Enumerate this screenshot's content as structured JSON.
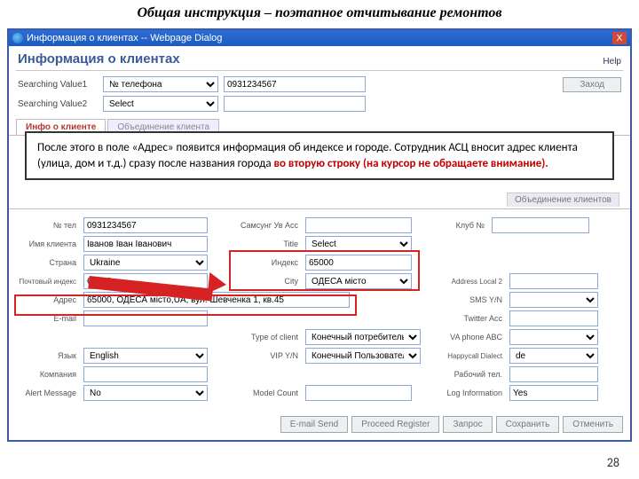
{
  "slide": {
    "title": "Общая инструкция – поэтапное отчитывание ремонтов",
    "page": "28"
  },
  "dialog": {
    "title": "Информация о клиентах -- Webpage Dialog",
    "close": "X"
  },
  "header": {
    "title": "Информация о клиентах",
    "help": "Help"
  },
  "search": {
    "label1": "Searching Value1",
    "sel1": "№ телефона",
    "val1": "0931234567",
    "label2": "Searching Value2",
    "sel2": "Select",
    "findBtn": "Заход"
  },
  "tabs": {
    "active": "Инфо о клиенте",
    "inactive": "Объединение клиента"
  },
  "note": {
    "line1": "После этого в поле «Адрес» появится информация об индексе и городе. Сотрудник АСЦ вносит адрес клиента (улица, дом и т.д.) сразу после названия города  ",
    "line2": "во вторую строку (на курсор не обращаете внимание)."
  },
  "section": {
    "hdr": "Объединение клиентов"
  },
  "form": {
    "telLbl": "№ тел",
    "tel": "0931234567",
    "accLbl": "Самсунг Ув Acc",
    "accVal": "",
    "clubLbl": "Клуб №",
    "nameLbl": "Имя клиента",
    "name": "Іванов Іван Іванович",
    "titleLbl": "Title",
    "title": "Select",
    "countryLbl": "Страна",
    "country": "Ukraine",
    "indexLbl": "Индекс",
    "index": "65000",
    "postalLbl": "Почтовый индекс",
    "postal": "65000",
    "cityLbl": "City",
    "city": "ОДЕСА місто",
    "addr2Lbl": "Address Local 2",
    "addrLbl": "Адрес",
    "addr": "65000, ОДЕСА місто,UA, вул. Шевченка 1, кв.45",
    "smsLbl": "SMS Y/N",
    "emailLbl": "E-mail",
    "twitterLbl": "Twitter Acc",
    "typeLbl": "Type of client",
    "type": "Конечный потребитель",
    "viaLbl": "VA phone ABC",
    "langLbl": "Язык",
    "lang": "English",
    "vipLbl": "VIP Y/N",
    "vip": "Конечный Пользователь",
    "dialLbl": "Happycall Dialect",
    "dial": "de",
    "companyLbl": "Компания",
    "workLbl": "Рабочий тел.",
    "alertLbl": "Alert Message",
    "alert": "No",
    "modelLbl": "Model Count",
    "logLbl": "Log Information",
    "log": "Yes"
  },
  "buttons": {
    "emailSend": "E-mail Send",
    "proceed": "Proceed Register",
    "zapros": "Запрос",
    "save": "Сохранить",
    "close": "Отменить"
  }
}
